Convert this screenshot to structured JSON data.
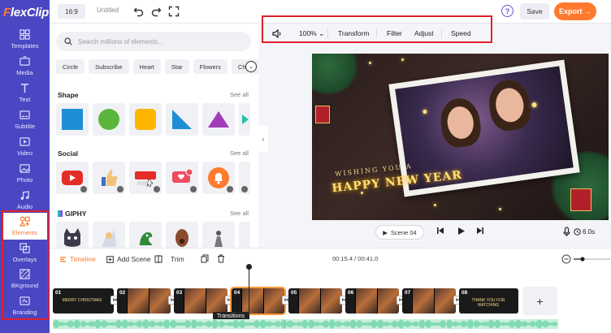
{
  "app": {
    "logo_f": "F",
    "logo_rest": "lexClip"
  },
  "sidebar": {
    "items": [
      {
        "label": "Templates",
        "icon": "templates-icon"
      },
      {
        "label": "Media",
        "icon": "media-icon"
      },
      {
        "label": "Text",
        "icon": "text-icon"
      },
      {
        "label": "Subtitle",
        "icon": "subtitle-icon"
      },
      {
        "label": "Video",
        "icon": "video-icon"
      },
      {
        "label": "Photo",
        "icon": "photo-icon"
      },
      {
        "label": "Audio",
        "icon": "audio-icon"
      },
      {
        "label": "Elements",
        "icon": "elements-icon"
      },
      {
        "label": "Overlays",
        "icon": "overlays-icon"
      },
      {
        "label": "BKground",
        "icon": "background-icon"
      },
      {
        "label": "Branding",
        "icon": "branding-icon"
      }
    ],
    "active": "Elements"
  },
  "topbar": {
    "ratio": "16:9",
    "title": "Untitled",
    "help": "?",
    "save": "Save",
    "export": "Export →"
  },
  "panel": {
    "search_placeholder": "Search millions of elements...",
    "chips": [
      "Circle",
      "Subscribe",
      "Heart",
      "Star",
      "Flowers",
      "Check"
    ],
    "sections": {
      "shape": {
        "title": "Shape",
        "see_all": "See all"
      },
      "social": {
        "title": "Social",
        "see_all": "See all"
      },
      "giphy": {
        "title": "GIPHY",
        "see_all": "See all"
      }
    }
  },
  "toolbar": {
    "zoom": "100%",
    "transform": "Transform",
    "filter": "Filter",
    "adjust": "Adjust",
    "speed": "Speed"
  },
  "preview": {
    "wish": "WISHING YOU A",
    "headline": "HAPPY NEW YEAR"
  },
  "playback": {
    "scene": "Scene 04",
    "duration": "6.0s"
  },
  "timeline": {
    "tabs": {
      "timeline": "Timeline",
      "add_scene": "Add Scene",
      "trim": "Trim"
    },
    "time": "00:15.4 / 00:41.0",
    "clips": [
      {
        "num": "01",
        "caption": "MERRY CHRISTMAS"
      },
      {
        "num": "02",
        "caption": ""
      },
      {
        "num": "03",
        "caption": ""
      },
      {
        "num": "04",
        "caption": ""
      },
      {
        "num": "05",
        "caption": ""
      },
      {
        "num": "06",
        "caption": ""
      },
      {
        "num": "07",
        "caption": ""
      },
      {
        "num": "08",
        "caption": "THANK YOU FOR WATCHING"
      }
    ],
    "tooltip": "Transitions",
    "add": "+"
  }
}
